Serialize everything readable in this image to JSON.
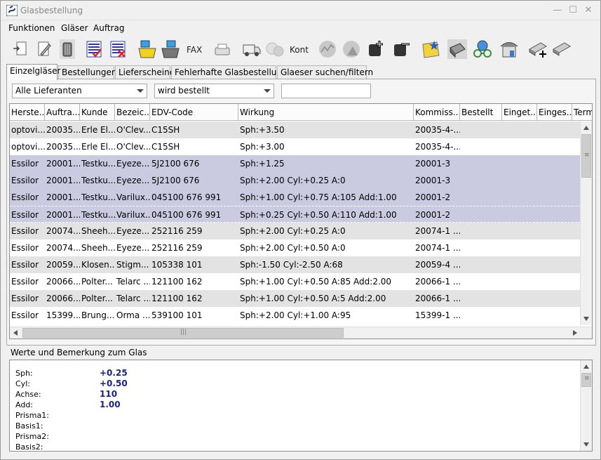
{
  "window": {
    "title": "Glasbestellung"
  },
  "menu": [
    "Funktionen",
    "Gläser",
    "Auftrag"
  ],
  "toolbar": {
    "fax_label": "FAX",
    "kont_label": "Kont"
  },
  "tabs": [
    "Einzelgläser",
    "Bestellungen",
    "Lieferscheine",
    "Fehlerhafte Glasbestellung",
    "Glaeser suchen/filtern"
  ],
  "filters": {
    "supplier": "Alle Lieferanten",
    "status": "wird bestellt",
    "search": ""
  },
  "columns": [
    "Herste...",
    "Auftra...",
    "Kunde",
    "Bezeic...",
    "EDV-Code",
    "Wirkung",
    "Kommiss...",
    "Bestellt",
    "Einget...",
    "Einges...",
    "Term"
  ],
  "rows": [
    [
      "optovi...",
      "20035...",
      "Erle El...",
      "O'Clev...",
      "C15SH",
      "Sph:+3.50",
      "20035-4-...",
      "",
      "",
      ""
    ],
    [
      "optovi...",
      "20035...",
      "Erle El...",
      "O'Clev...",
      "C15SH",
      "Sph:+3.00",
      "20035-4-...",
      "",
      "",
      ""
    ],
    [
      "Essilor",
      "20001...",
      "Testku...",
      "Eyeze...",
      "5J2100 676",
      "Sph:+1.25",
      "20001-3",
      "",
      "",
      ""
    ],
    [
      "Essilor",
      "20001...",
      "Testku...",
      "Eyeze...",
      "5J2100 676",
      "Sph:+2.00 Cyl:+0.25 A:0",
      "20001-3",
      "",
      "",
      ""
    ],
    [
      "Essilor",
      "20001...",
      "Testku...",
      "Varilux...",
      "045100 676 991",
      "Sph:+1.00 Cyl:+0.75 A:105 Add:1.00",
      "20001-2",
      "",
      "",
      ""
    ],
    [
      "Essilor",
      "20001...",
      "Testku...",
      "Varilux...",
      "045100 676 991",
      "Sph:+0.25 Cyl:+0.50 A:110 Add:1.00",
      "20001-2",
      "",
      "",
      ""
    ],
    [
      "Essilor",
      "20074...",
      "Sheeh...",
      "Eyeze...",
      "252116 259",
      "Sph:+2.00 Cyl:+0.25 A:0",
      "20074-1 ...",
      "",
      "",
      ""
    ],
    [
      "Essilor",
      "20074...",
      "Sheeh...",
      "Eyeze...",
      "252116 259",
      "Sph:+2.00 Cyl:+0.50 A:0",
      "20074-1 ...",
      "",
      "",
      ""
    ],
    [
      "Essilor",
      "20059...",
      "Klosen...",
      "Stigm...",
      "105338 101",
      "Sph:-1.50 Cyl:-2.50 A:68",
      "20059-4 ...",
      "",
      "",
      ""
    ],
    [
      "Essilor",
      "20066...",
      "Polter...",
      "Telarc ...",
      "121100 162",
      "Sph:+1.00 Cyl:+0.50 A:85 Add:2.00",
      "20066-1 ...",
      "",
      "",
      ""
    ],
    [
      "Essilor",
      "20066...",
      "Polter...",
      "Telarc ...",
      "121100 162",
      "Sph:+1.00 Cyl:+0.50 A:5 Add:2.00",
      "20066-1 ...",
      "",
      "",
      ""
    ],
    [
      "Essilor",
      "15399...",
      "Brung...",
      "Orma ...",
      "539100 101",
      "Sph:+2.00 Cyl:+1.00 A:95",
      "15399-1 ...",
      "",
      "",
      ""
    ]
  ],
  "details": {
    "section_title": "Werte und Bemerkung zum Glas",
    "fields": [
      {
        "label": "Sph:",
        "value": "+0.25"
      },
      {
        "label": "Cyl:",
        "value": "+0.50"
      },
      {
        "label": "Achse:",
        "value": "110"
      },
      {
        "label": "Add:",
        "value": "1.00"
      },
      {
        "label": "Prisma1:",
        "value": ""
      },
      {
        "label": "Basis1:",
        "value": ""
      },
      {
        "label": "Prisma2:",
        "value": ""
      },
      {
        "label": "Basis2:",
        "value": ""
      }
    ]
  },
  "colors": {
    "selected_row": "#cacae0",
    "alt_row": "#e3e3e3",
    "value_text": "#1a237e"
  }
}
